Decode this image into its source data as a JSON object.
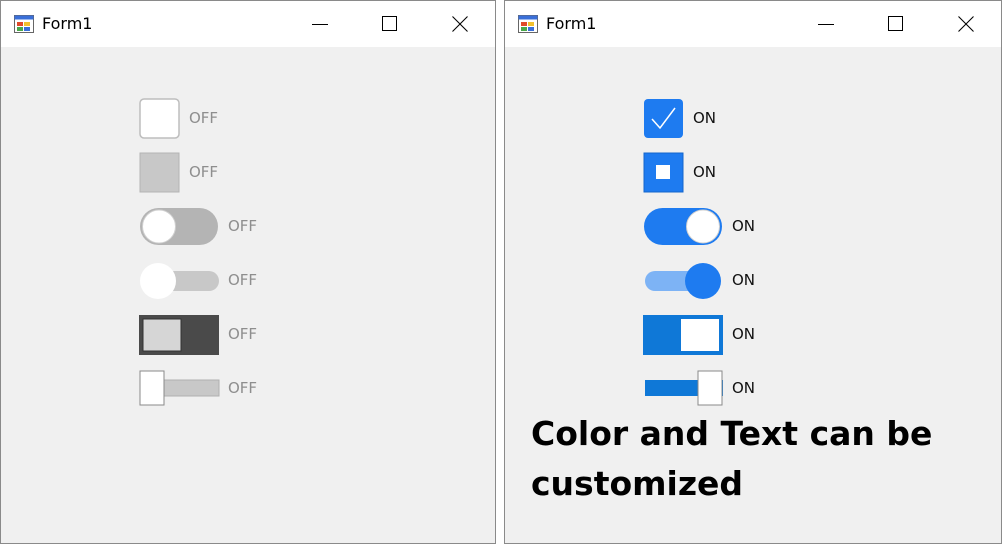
{
  "windows": [
    {
      "title": "Form1",
      "state": "off",
      "toggles": [
        {
          "label": "OFF",
          "style": "checkbox"
        },
        {
          "label": "OFF",
          "style": "square-fill"
        },
        {
          "label": "OFF",
          "style": "ios-switch"
        },
        {
          "label": "OFF",
          "style": "material-switch"
        },
        {
          "label": "OFF",
          "style": "metro-switch"
        },
        {
          "label": "OFF",
          "style": "slider-switch"
        }
      ]
    },
    {
      "title": "Form1",
      "state": "on",
      "toggles": [
        {
          "label": "ON",
          "style": "checkbox"
        },
        {
          "label": "ON",
          "style": "square-fill"
        },
        {
          "label": "ON",
          "style": "ios-switch"
        },
        {
          "label": "ON",
          "style": "material-switch"
        },
        {
          "label": "ON",
          "style": "metro-switch"
        },
        {
          "label": "ON",
          "style": "slider-switch"
        }
      ],
      "caption": "Color and Text can be customized"
    }
  ],
  "icons": {
    "app": "form-app-icon",
    "minimize": "minimize-icon",
    "maximize": "maximize-icon",
    "close": "close-icon"
  },
  "colors": {
    "accent": "#1e7bf0",
    "metro_on": "#0f78d7",
    "off_gray": "#bdbdbd",
    "off_dark": "#4a4a4a",
    "window_bg": "#f0f0f0"
  }
}
